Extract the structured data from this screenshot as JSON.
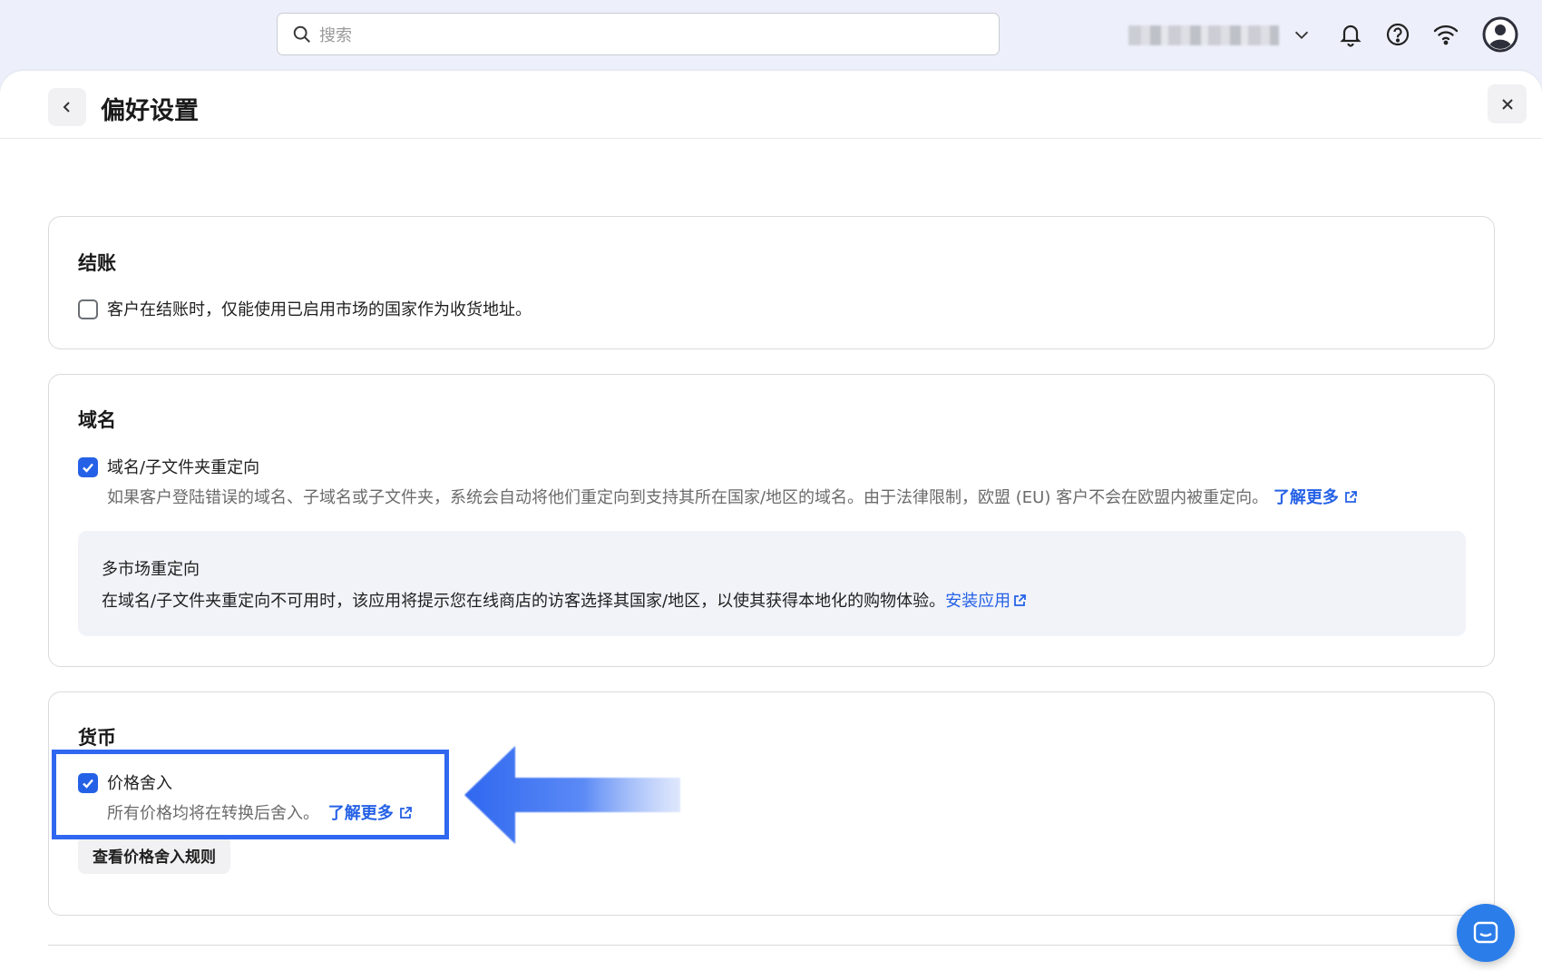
{
  "topbar": {
    "search_placeholder": "搜索",
    "icons": [
      "search-icon",
      "chevron-down-icon",
      "bell-icon",
      "help-icon",
      "wifi-icon",
      "avatar-icon"
    ]
  },
  "page": {
    "title": "偏好设置"
  },
  "checkout": {
    "title": "结账",
    "option_label": "客户在结账时，仅能使用已启用市场的国家作为收货地址。",
    "checked": false
  },
  "domain": {
    "title": "域名",
    "option_label": "域名/子文件夹重定向",
    "checked": true,
    "description": "如果客户登陆错误的域名、子域名或子文件夹，系统会自动将他们重定向到支持其所在国家/地区的域名。由于法律限制，欧盟 (EU) 客户不会在欧盟内被重定向。",
    "learn_more": "了解更多",
    "info_box": {
      "title": "多市场重定向",
      "description": "在域名/子文件夹重定向不可用时，该应用将提示您在线商店的访客选择其国家/地区，以使其获得本地化的购物体验。",
      "link": "安装应用"
    }
  },
  "currency": {
    "title": "货币",
    "option_label": "价格舍入",
    "checked": true,
    "description": "所有价格均将在转换后舍入。",
    "learn_more": "了解更多",
    "button_label": "查看价格舍入规则"
  },
  "colors": {
    "accent": "#2561e6",
    "highlight": "#2f67f0",
    "chat": "#2b7de9"
  }
}
